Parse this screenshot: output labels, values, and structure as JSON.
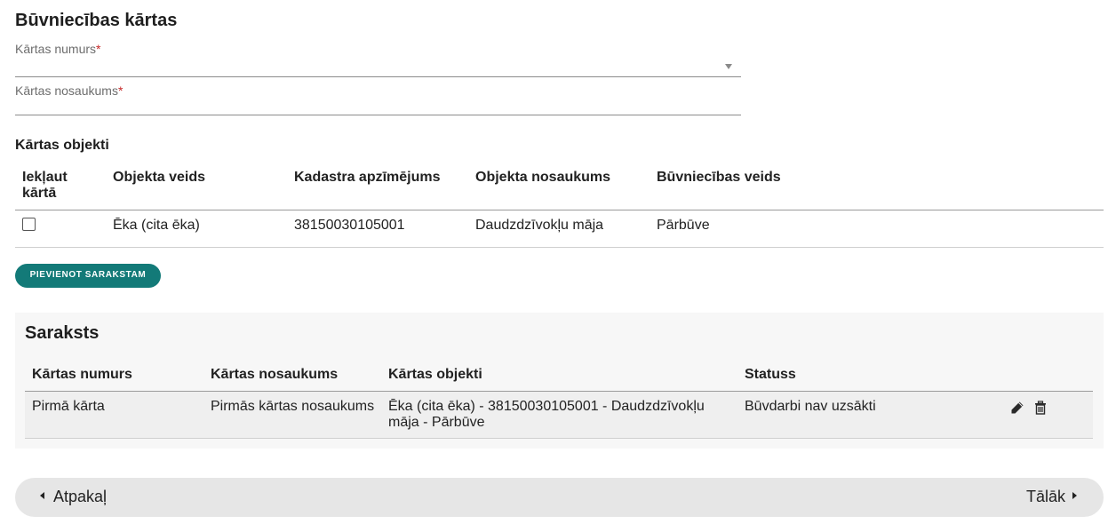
{
  "page": {
    "title": "Būvniecības kārtas"
  },
  "form": {
    "number_label": "Kārtas numurs",
    "number_value": "",
    "name_label": "Kārtas nosaukums",
    "name_value": "",
    "required_mark": "*"
  },
  "objects": {
    "title": "Kārtas objekti",
    "headers": {
      "include": "Iekļaut kārtā",
      "type": "Objekta veids",
      "cadastre": "Kadastra apzīmējums",
      "name": "Objekta nosaukums",
      "construction": "Būvniecības veids"
    },
    "rows": [
      {
        "checked": false,
        "type": "Ēka (cita ēka)",
        "cadastre": "38150030105001",
        "name": "Daudzdzīvokļu māja",
        "construction": "Pārbūve"
      }
    ],
    "add_button_label": "PIEVIENOT SARAKSTAM"
  },
  "list": {
    "title": "Saraksts",
    "headers": {
      "number": "Kārtas numurs",
      "name": "Kārtas nosaukums",
      "objects": "Kārtas objekti",
      "status": "Statuss"
    },
    "rows": [
      {
        "number": "Pirmā kārta",
        "name": "Pirmās kārtas nosaukums",
        "objects": "Ēka (cita ēka) - 38150030105001 - Daudzdzīvokļu māja - Pārbūve",
        "status": "Būvdarbi nav uzsākti",
        "actions": [
          "pencil-icon",
          "trash-icon"
        ]
      }
    ]
  },
  "navigation": {
    "back_label": "Atpakaļ",
    "next_label": "Tālāk"
  },
  "colors": {
    "primary_button": "#137a78",
    "nav_bar": "#e6e6e6",
    "panel": "#f7f7f7",
    "required": "#c62828"
  }
}
